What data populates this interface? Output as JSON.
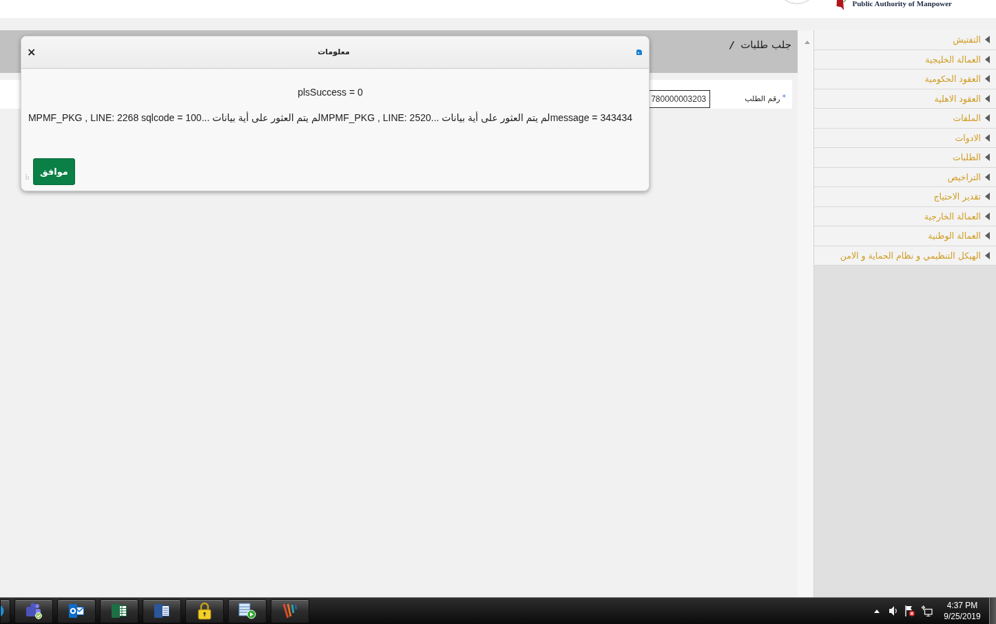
{
  "header": {
    "org_name": "Public Authority of Manpower"
  },
  "page_header": {
    "title": "جلب طلبات",
    "separator": "/"
  },
  "form": {
    "fields": [
      {
        "label": "رقم الطلب",
        "required_mark": "*",
        "value": "780000003203"
      }
    ]
  },
  "dialog": {
    "title": "معلومات",
    "close": "×",
    "lines": [
      "plsSuccess = 0",
      "message = 343434لم يتم العثور على أية بيانات ...MPMF_PKG , LINE: 2520لم يتم العثور على أية بيانات ...MPMF_PKG , LINE: 2268 sqlcode = 100"
    ],
    "buttons": [
      {
        "label": "موافق"
      }
    ]
  },
  "sidebar": {
    "items": [
      {
        "label": "التفتيش",
        "expanded": false
      },
      {
        "label": "العمالة الخليجية",
        "expanded": false
      },
      {
        "label": "العقود الحكومية",
        "expanded": false
      },
      {
        "label": "العقود الاهلية",
        "expanded": false
      },
      {
        "label": "الملفات",
        "expanded": false
      },
      {
        "label": "الادوات",
        "expanded": false
      },
      {
        "label": "الطلبات",
        "expanded": false
      },
      {
        "label": "التراخيص",
        "expanded": false
      },
      {
        "label": "تقدير الاحتياج",
        "expanded": false
      },
      {
        "label": "العمالة الخارجية",
        "expanded": false
      },
      {
        "label": "العمالة الوطنية",
        "expanded": false
      },
      {
        "label": "الهيكل التنظيمي و نظام الحماية و الامن",
        "expanded": false
      }
    ]
  },
  "taskbar": {
    "clock": {
      "time": "4:37 PM",
      "date": "9/25/2019"
    }
  }
}
